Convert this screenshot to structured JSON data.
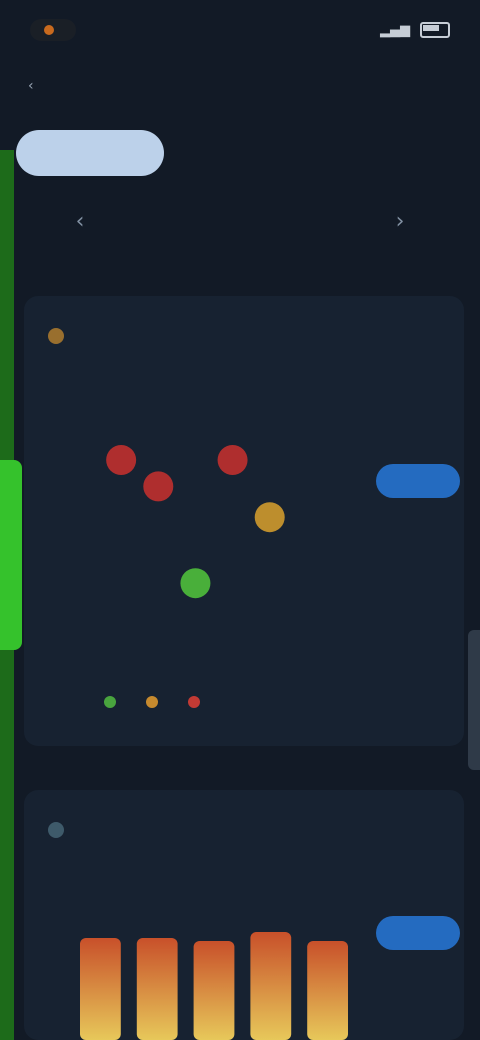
{
  "status": {
    "time": "",
    "signal": "",
    "battery": ""
  },
  "header": {
    "back_label": "",
    "title": ""
  },
  "tabs": [
    {
      "label": "",
      "active": true
    },
    {
      "label": "",
      "active": false
    },
    {
      "label": "",
      "active": false
    }
  ],
  "range": {
    "label": "",
    "prev_icon": "chevron-left-icon",
    "next_icon": "chevron-right-icon"
  },
  "card1": {
    "icon": "warning-icon",
    "title": "",
    "subtitle": "",
    "badge": "",
    "badge_sub": "",
    "y_labels": [
      "",
      ""
    ],
    "button_label": "",
    "axis_caption": "",
    "legend": [
      {
        "label": "",
        "color": "#49a43e"
      },
      {
        "label": "",
        "color": "#c68a2e"
      },
      {
        "label": "",
        "color": "#c23a34"
      }
    ],
    "chart_data": {
      "type": "scatter",
      "ylim": [
        0,
        5
      ],
      "xlim": [
        0,
        7
      ],
      "points": [
        {
          "x": 1,
          "y": 4.0,
          "level": "high",
          "color": "#c0302f"
        },
        {
          "x": 2,
          "y": 3.4,
          "level": "high",
          "color": "#c0302f"
        },
        {
          "x": 4,
          "y": 4.0,
          "level": "high",
          "color": "#c0302f"
        },
        {
          "x": 5,
          "y": 2.7,
          "level": "medium",
          "color": "#cf9a2e"
        },
        {
          "x": 3,
          "y": 1.2,
          "level": "low",
          "color": "#4fbf3c"
        }
      ]
    }
  },
  "card2": {
    "icon": "leaf-icon",
    "title": "",
    "subtitle": "",
    "badge": "",
    "badge_sub": "",
    "y_labels": [
      "",
      ""
    ],
    "button_label": "",
    "chart_data": {
      "type": "bar",
      "categories": [
        "",
        "",
        "",
        "",
        ""
      ],
      "values": [
        3.4,
        3.4,
        3.3,
        3.6,
        3.3
      ],
      "ylim": [
        0,
        4
      ]
    }
  },
  "colors": {
    "background": "#121a26",
    "card": "#172231",
    "accent": "#246bc0",
    "tab_active": "#bcd1ea",
    "edge_active": "#35c22c"
  }
}
